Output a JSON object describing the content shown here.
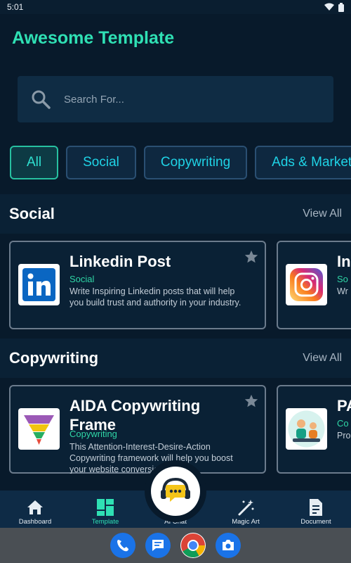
{
  "status_bar": {
    "time": "5:01"
  },
  "app": {
    "title": "Awesome Template"
  },
  "search": {
    "placeholder": "Search For..."
  },
  "categories": [
    {
      "label": "All",
      "active": true
    },
    {
      "label": "Social",
      "active": false
    },
    {
      "label": "Copywriting",
      "active": false
    },
    {
      "label": "Ads & Marketing",
      "active": false
    }
  ],
  "sections": [
    {
      "title": "Social",
      "view_all": "View All",
      "cards": [
        {
          "title": "Linkedin Post",
          "category": "Social",
          "description": "Write Inspiring Linkedin posts that will help you build trust and authority in your industry.",
          "icon": "linkedin-logo"
        },
        {
          "title": "In",
          "category": "So",
          "description": "Wr po",
          "icon": "instagram-logo"
        }
      ]
    },
    {
      "title": "Copywriting",
      "view_all": "View All",
      "cards": [
        {
          "title": "AIDA Copywriting Frame",
          "category": "Copywriting",
          "description": "This Attention-Interest-Desire-Action Copywriting framework will help you boost your website conversion.",
          "icon": "funnel-logo"
        },
        {
          "title": "PA",
          "category": "Co",
          "description": "Pro wil eff",
          "icon": "team-illustration"
        }
      ]
    }
  ],
  "bottom_nav": [
    {
      "label": "Dashboard",
      "icon": "home-icon",
      "active": false
    },
    {
      "label": "Template",
      "icon": "template-grid-icon",
      "active": true
    },
    {
      "label": "AI Chat",
      "icon": "chat-support-icon",
      "active": false
    },
    {
      "label": "Magic Art",
      "icon": "magic-wand-icon",
      "active": false
    },
    {
      "label": "Document",
      "icon": "document-icon",
      "active": false
    }
  ],
  "dock": [
    "phone",
    "messages",
    "chrome",
    "camera"
  ],
  "colors": {
    "accent": "#2fe0b4",
    "background": "#081a2b",
    "card_border": "#6b7b8c",
    "chip_text": "#1fd3e6"
  }
}
